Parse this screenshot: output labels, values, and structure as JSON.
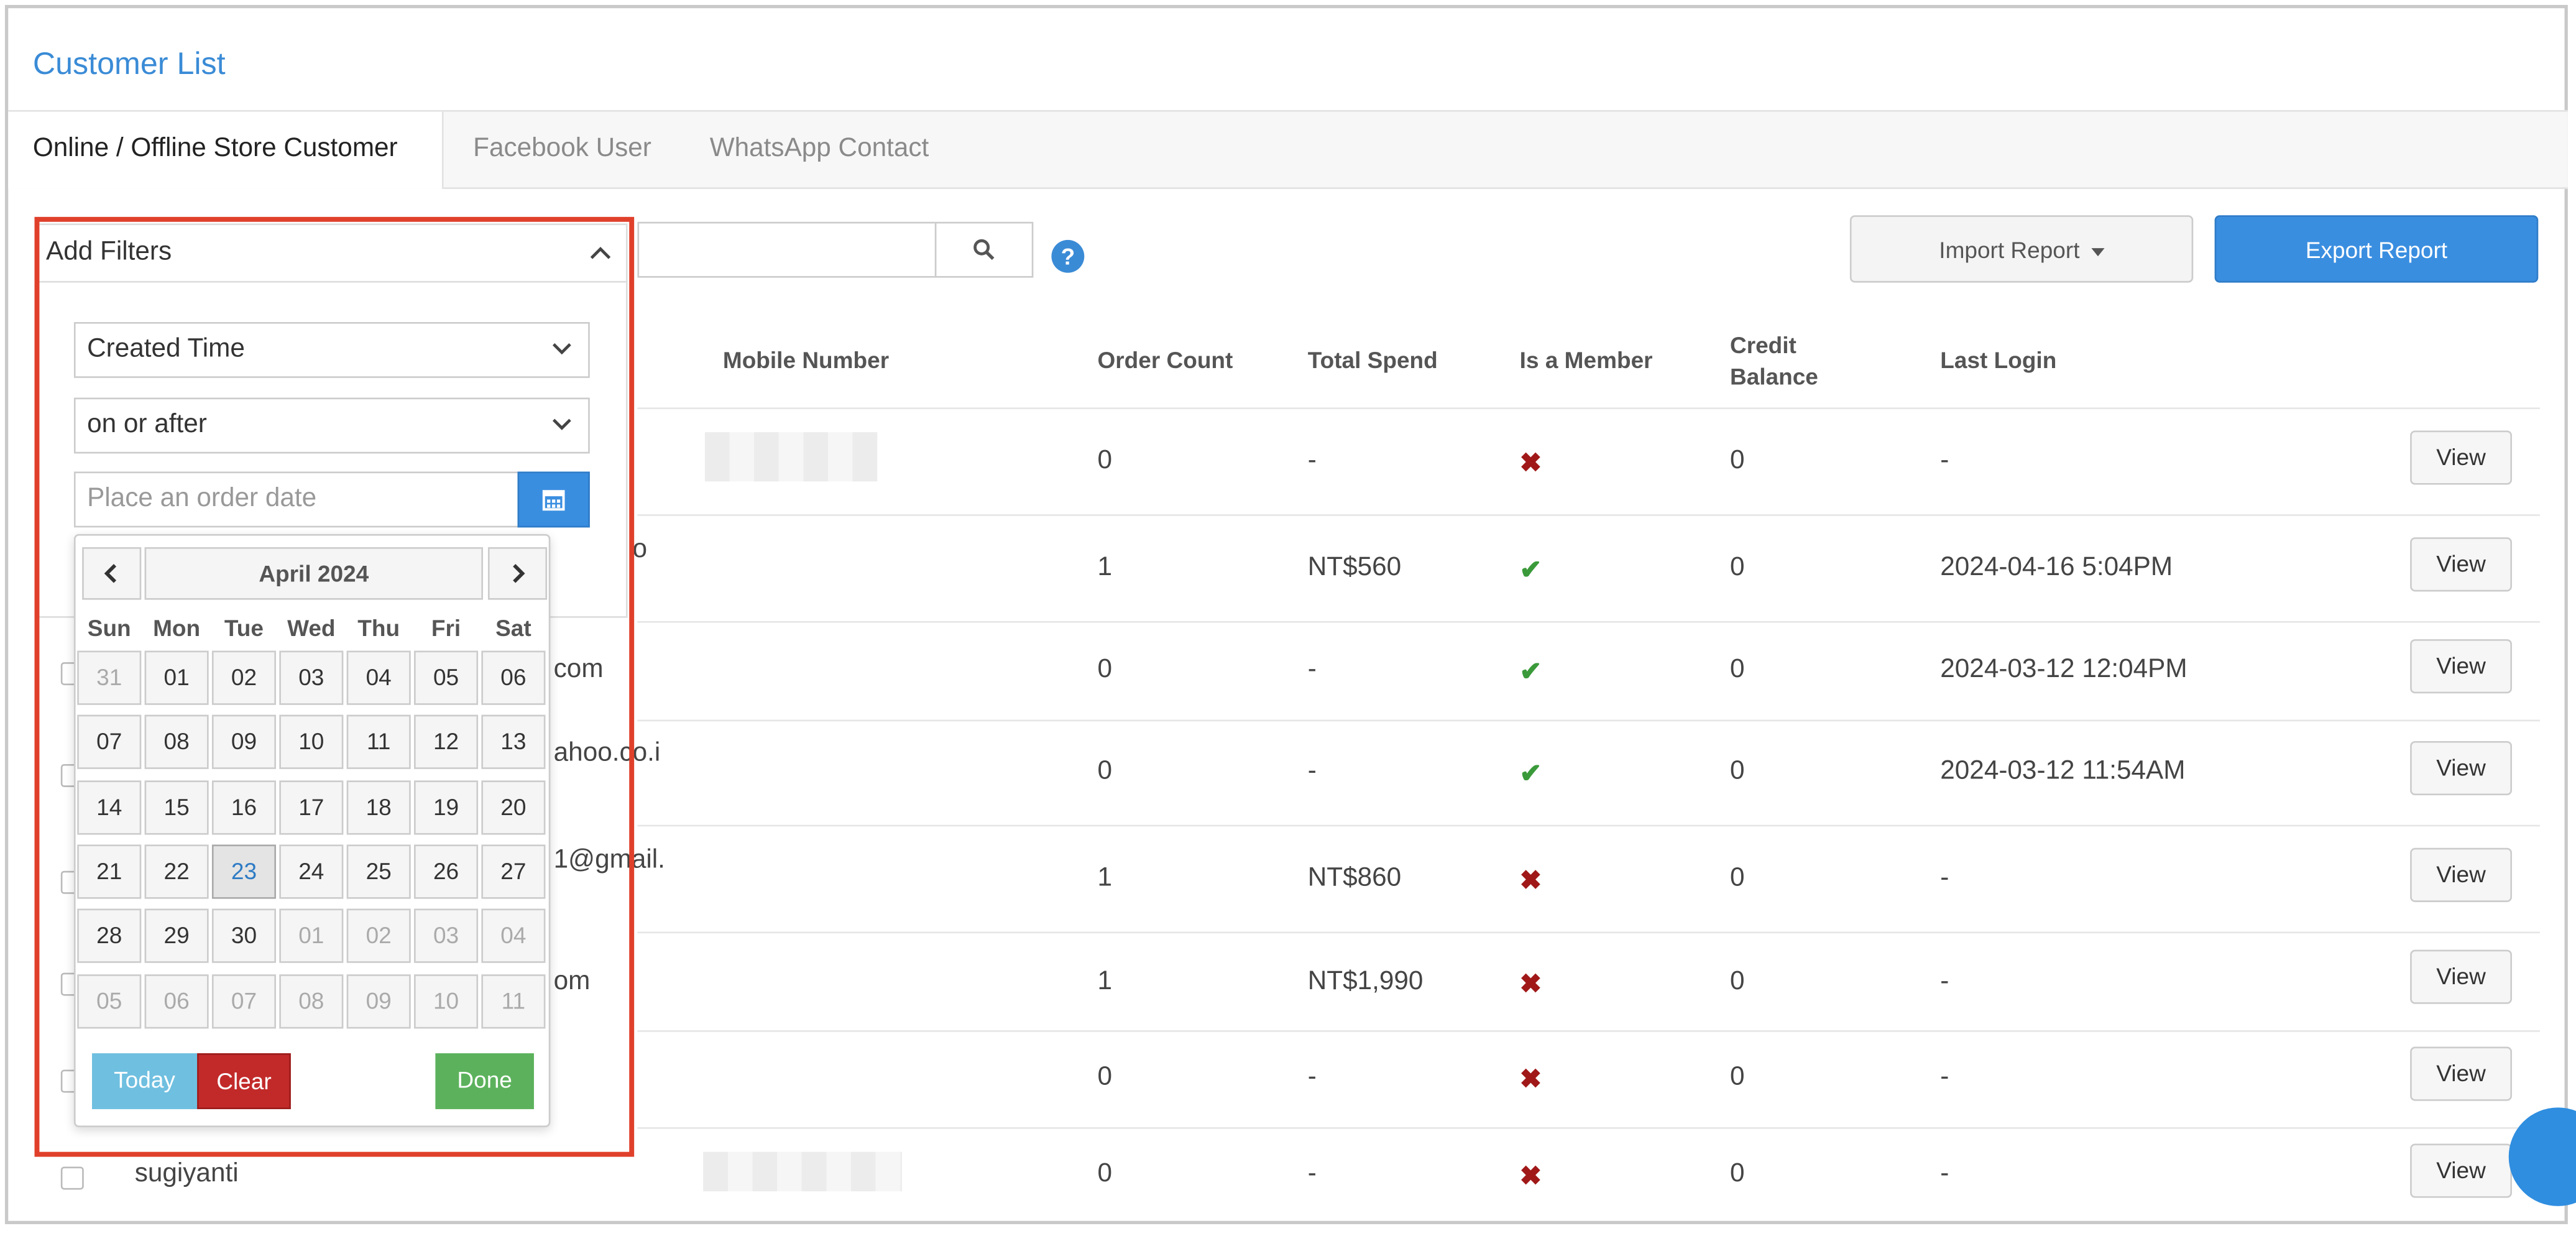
{
  "page": {
    "title": "Customer List"
  },
  "tabs": [
    "Online / Offline Store Customer",
    "Facebook User",
    "WhatsApp Contact"
  ],
  "toolbar": {
    "import_label": "Import Report",
    "export_label": "Export Report",
    "help_glyph": "?"
  },
  "table": {
    "columns": {
      "mobile": "Mobile Number",
      "order_count": "Order Count",
      "total_spend": "Total Spend",
      "member": "Is a Member",
      "credit": "Credit Balance",
      "last_login": "Last Login"
    },
    "view_label": "View",
    "rows": [
      {
        "name": "",
        "email_fragment": "",
        "order_count": "0",
        "total_spend": "-",
        "member": false,
        "credit": "0",
        "last_login": "-"
      },
      {
        "name": "",
        "email_fragment": "o",
        "order_count": "1",
        "total_spend": "NT$560",
        "member": true,
        "credit": "0",
        "last_login": "2024-04-16 5:04PM"
      },
      {
        "name": "",
        "email_fragment": "com",
        "order_count": "0",
        "total_spend": "-",
        "member": true,
        "credit": "0",
        "last_login": "2024-03-12 12:04PM"
      },
      {
        "name": "",
        "email_fragment": "ahoo.co.i",
        "order_count": "0",
        "total_spend": "-",
        "member": true,
        "credit": "0",
        "last_login": "2024-03-12 11:54AM"
      },
      {
        "name": "",
        "email_fragment": "1@gmail.",
        "order_count": "1",
        "total_spend": "NT$860",
        "member": false,
        "credit": "0",
        "last_login": "-"
      },
      {
        "name": "",
        "email_fragment": "om",
        "order_count": "1",
        "total_spend": "NT$1,990",
        "member": false,
        "credit": "0",
        "last_login": "-"
      },
      {
        "name": "",
        "email_fragment": "",
        "order_count": "0",
        "total_spend": "-",
        "member": false,
        "credit": "0",
        "last_login": "-"
      },
      {
        "name": "sugiyanti",
        "email_fragment": "",
        "order_count": "0",
        "total_spend": "-",
        "member": false,
        "credit": "0",
        "last_login": "-"
      }
    ]
  },
  "filters": {
    "header": "Add Filters",
    "field": "Created Time",
    "operator": "on or after",
    "date_placeholder": "Place an order date"
  },
  "calendar": {
    "month_label": "April 2024",
    "weekdays": [
      "Sun",
      "Mon",
      "Tue",
      "Wed",
      "Thu",
      "Fri",
      "Sat"
    ],
    "weeks": [
      [
        "31",
        "01",
        "02",
        "03",
        "04",
        "05",
        "06"
      ],
      [
        "07",
        "08",
        "09",
        "10",
        "11",
        "12",
        "13"
      ],
      [
        "14",
        "15",
        "16",
        "17",
        "18",
        "19",
        "20"
      ],
      [
        "21",
        "22",
        "23",
        "24",
        "25",
        "26",
        "27"
      ],
      [
        "28",
        "29",
        "30",
        "01",
        "02",
        "03",
        "04"
      ],
      [
        "05",
        "06",
        "07",
        "08",
        "09",
        "10",
        "11"
      ]
    ],
    "today": "23",
    "today_label": "Today",
    "clear_label": "Clear",
    "done_label": "Done"
  },
  "colors": {
    "accent": "#3a8ee0",
    "highlight_frame": "#e0402b",
    "check": "#3a9a3a",
    "cross": "#a01818",
    "today_btn": "#6fbfe0",
    "clear_btn": "#c22a2a",
    "done_btn": "#5cb25c"
  },
  "icons": {
    "search": "search-icon",
    "help": "help-icon",
    "calendar": "calendar-icon",
    "prev": "chevron-left-icon",
    "next": "chevron-right-icon",
    "collapse": "chevron-up-icon"
  }
}
